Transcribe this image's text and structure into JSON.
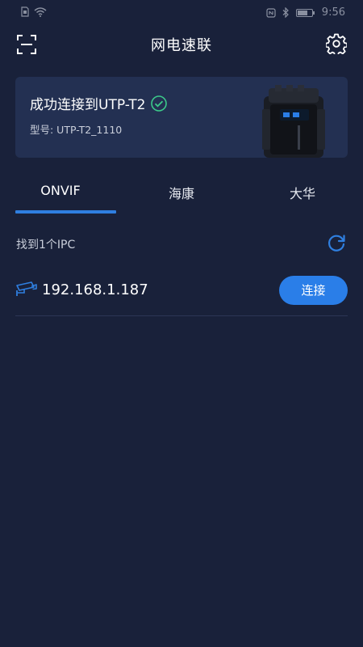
{
  "status_bar": {
    "time": "9:56"
  },
  "header": {
    "title": "网电速联"
  },
  "device_card": {
    "connected_text": "成功连接到UTP-T2",
    "model_text": "型号: UTP-T2_1110"
  },
  "tabs": [
    {
      "label": "ONVIF",
      "active": true
    },
    {
      "label": "海康",
      "active": false
    },
    {
      "label": "大华",
      "active": false
    }
  ],
  "found": {
    "text": "找到1个IPC"
  },
  "ipc_list": [
    {
      "ip": "192.168.1.187",
      "button_label": "连接"
    }
  ],
  "colors": {
    "background": "#19213a",
    "card": "#233052",
    "accent": "#2a7ee8",
    "success": "#3cc98a"
  }
}
